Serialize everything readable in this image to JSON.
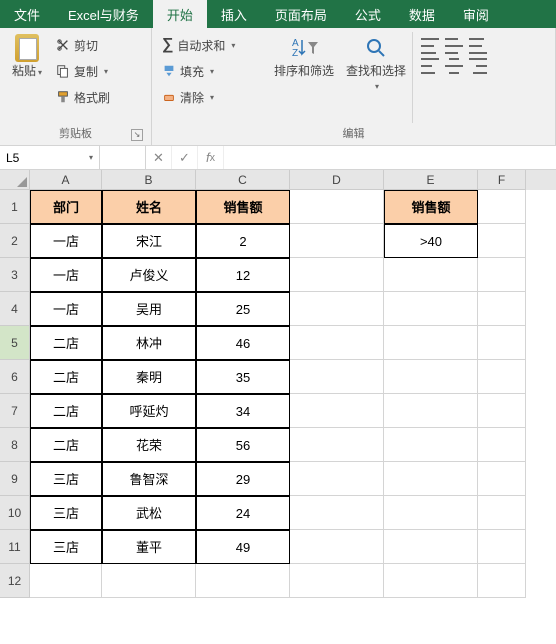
{
  "tabs": [
    "文件",
    "Excel与财务",
    "开始",
    "插入",
    "页面布局",
    "公式",
    "数据",
    "审阅"
  ],
  "active_tab": 2,
  "ribbon": {
    "clipboard": {
      "paste": "粘贴",
      "cut": "剪切",
      "copy": "复制",
      "format_painter": "格式刷",
      "label": "剪贴板"
    },
    "editing": {
      "autosum": "自动求和",
      "fill": "填充",
      "clear": "清除",
      "sort_filter": "排序和筛选",
      "find_select": "查找和选择",
      "label": "编辑"
    }
  },
  "name_box": "L5",
  "columns": [
    "A",
    "B",
    "C",
    "D",
    "E",
    "F"
  ],
  "col_widths": [
    "wA",
    "wB",
    "wC",
    "wD",
    "wE",
    "wF"
  ],
  "active_row": 5,
  "headers": {
    "A": "部门",
    "B": "姓名",
    "C": "销售额",
    "E": "销售额"
  },
  "criteria": {
    "E": ">40"
  },
  "rows": [
    {
      "A": "一店",
      "B": "宋江",
      "C": "2"
    },
    {
      "A": "一店",
      "B": "卢俊义",
      "C": "12"
    },
    {
      "A": "一店",
      "B": "吴用",
      "C": "25"
    },
    {
      "A": "二店",
      "B": "林冲",
      "C": "46"
    },
    {
      "A": "二店",
      "B": "秦明",
      "C": "35"
    },
    {
      "A": "二店",
      "B": "呼延灼",
      "C": "34"
    },
    {
      "A": "二店",
      "B": "花荣",
      "C": "56"
    },
    {
      "A": "三店",
      "B": "鲁智深",
      "C": "29"
    },
    {
      "A": "三店",
      "B": "武松",
      "C": "24"
    },
    {
      "A": "三店",
      "B": "董平",
      "C": "49"
    }
  ]
}
